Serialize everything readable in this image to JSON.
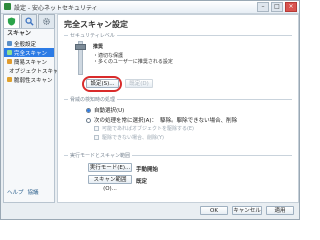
{
  "window": {
    "title": "設定 - 安心ネットセキュリティ",
    "minimize": "–",
    "maximize": "□",
    "close": "×"
  },
  "toolbar": {
    "tabs": [
      {
        "icon": "shield-icon",
        "active": true
      },
      {
        "icon": "search-icon",
        "active": false
      },
      {
        "icon": "gear-icon",
        "active": false
      }
    ]
  },
  "sidebar": {
    "header": "スキャン",
    "items": [
      {
        "label": "全般設定",
        "icon_color": "#5a8fc7",
        "selected": false
      },
      {
        "label": "完全スキャン",
        "icon_color": "#2aa34a",
        "selected": true
      },
      {
        "label": "簡易スキャン",
        "icon_color": "#e09b2d",
        "selected": false
      },
      {
        "label": "オブジェクトスキャン",
        "icon_color": "#3d74c2",
        "selected": false
      },
      {
        "label": "脆弱性スキャン",
        "icon_color": "#e0a22d",
        "selected": false
      }
    ],
    "footer": {
      "help": "ヘルプ",
      "support": "協議"
    }
  },
  "main": {
    "title": "完全スキャン設定",
    "security_level": {
      "group_label": "セキュリティレベル",
      "level": "推奨",
      "desc1": "・適切な保護",
      "desc2": "・多くのユーザーに推奨される設定",
      "settings_button": "設定(S)...",
      "default_button": "既定(D)"
    },
    "threat_action": {
      "group_label": "脅威の検知時の処理",
      "option_auto": "自動選択(U)",
      "option_auto_selected": true,
      "option_select": "次の処理を常に選択(A)：",
      "option_select_detail": "駆除。駆除できない場合、削除",
      "option_select_selected": false,
      "check1": "可能であればオブジェクトを駆除する(E)",
      "check2": "駆除できない場合、削除(Y)"
    },
    "run_mode": {
      "group_label": "実行モードとスキャン範囲",
      "mode_button": "実行モード(E)...",
      "mode_value": "手動開始",
      "scope_button": "スキャン範囲(O)...",
      "scope_value": "既定"
    }
  },
  "footer": {
    "ok": "OK",
    "cancel": "キャンセル",
    "apply": "適用"
  }
}
